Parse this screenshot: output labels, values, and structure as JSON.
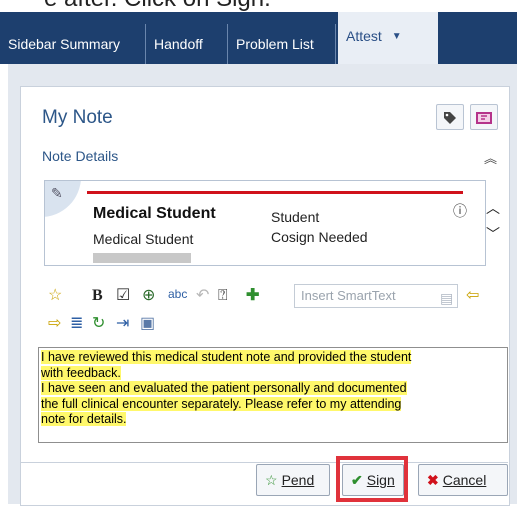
{
  "caption": "e after. Click on Sign.",
  "tabs": [
    {
      "label": "Sidebar Summary"
    },
    {
      "label": "Handoff"
    },
    {
      "label": "Problem List"
    },
    {
      "label": "Attest"
    }
  ],
  "note": {
    "title": "My Note",
    "details_label": "Note Details",
    "header_icons": [
      "tag-icon",
      "note-book-icon"
    ]
  },
  "student_card": {
    "name": "Medical Student",
    "role": "Medical Student",
    "type": "Student",
    "status": "Cosign Needed",
    "accent_color": "#d0111b"
  },
  "toolbar": {
    "bold_label": "B",
    "smarttext_placeholder": "Insert SmartText"
  },
  "note_text": {
    "line1": "I have reviewed this medical student note and provided the student",
    "line2": "with feedback.",
    "line3": "I have seen and evaluated the patient personally and documented",
    "line4": "the full clinical encounter separately.  Please refer to my attending",
    "line5": "note for details.",
    "highlight_color": "#fff86b"
  },
  "actions": {
    "pend_label": "Pend",
    "sign_label": "Sign",
    "cancel_label": "Cancel",
    "sign_highlight_color": "#e0323b"
  }
}
